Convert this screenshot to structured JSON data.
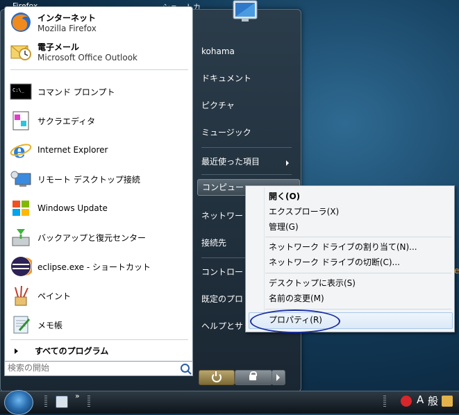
{
  "desktop": {
    "top_left_label": "Firefox",
    "top_mid_label": "ショートカ"
  },
  "start_menu": {
    "pinned": [
      {
        "title": "インターネット",
        "subtitle": "Mozilla Firefox"
      },
      {
        "title": "電子メール",
        "subtitle": "Microsoft Office Outlook"
      }
    ],
    "recent": [
      "コマンド プロンプト",
      "サクラエディタ",
      "Internet Explorer",
      "リモート デスクトップ接続",
      "Windows Update",
      "バックアップと復元センター",
      "eclipse.exe - ショートカット",
      "ペイント",
      "メモ帳"
    ],
    "all_programs": "すべてのプログラム",
    "search_placeholder": "検索の開始",
    "right": {
      "user": "kohama",
      "documents": "ドキュメント",
      "pictures": "ピクチャ",
      "music": "ミュージック",
      "recent_items": "最近使った項目",
      "computer": "コンピュー",
      "network": "ネットワー",
      "connect": "接続先",
      "control_panel": "コントロー",
      "default_programs": "既定のプロ",
      "help": "ヘルプとサ"
    }
  },
  "context_menu": {
    "items": [
      {
        "label": "開く(O)",
        "bold": true
      },
      {
        "label": "エクスプローラ(X)"
      },
      {
        "label": "管理(G)"
      },
      {
        "label": "ネットワーク ドライブの割り当て(N)..."
      },
      {
        "label": "ネットワーク ドライブの切断(C)..."
      },
      {
        "label": "デスクトップに表示(S)"
      },
      {
        "label": "名前の変更(M)"
      },
      {
        "label": "プロパティ(R)"
      }
    ]
  },
  "taskbar": {
    "chevron": "»",
    "ime_mode": "A",
    "ime_kanji": "般"
  },
  "colors": {
    "highlight_circle": "#1b2ea0",
    "accent_orange": "#e88a20"
  }
}
